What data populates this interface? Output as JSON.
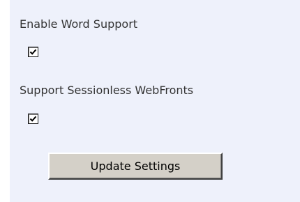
{
  "settings": {
    "word_support": {
      "label": "Enable Word Support",
      "checked": true
    },
    "sessionless_webfronts": {
      "label": "Support Sessionless WebFronts",
      "checked": true
    }
  },
  "actions": {
    "update_label": "Update Settings"
  },
  "icons": {
    "checkmark": "checkmark-icon"
  },
  "colors": {
    "panel_background": "#eef1fb",
    "label_text": "#333333",
    "button_face": "#d4d0c8"
  }
}
